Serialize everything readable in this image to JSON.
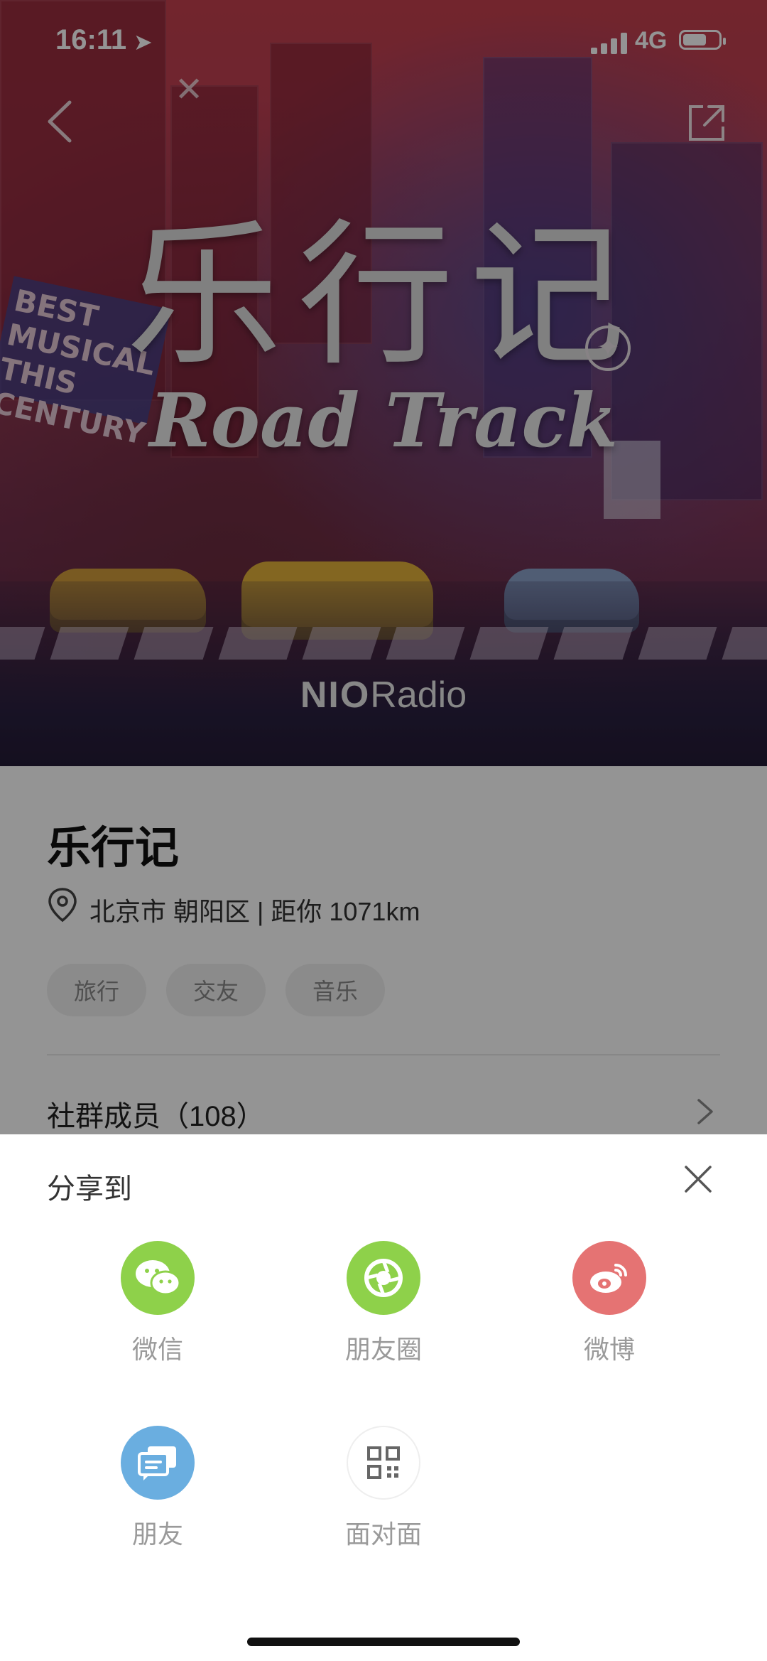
{
  "status_bar": {
    "time": "16:11",
    "network": "4G"
  },
  "hero": {
    "title_cn": "乐行记",
    "title_en": "Road Track",
    "brand_bold": "NIO",
    "brand_light": "Radio"
  },
  "group": {
    "name": "乐行记",
    "location": "北京市 朝阳区 | 距你 1071km",
    "tags": [
      "旅行",
      "交友",
      "音乐"
    ],
    "members_label": "社群成员（108）"
  },
  "share_sheet": {
    "title": "分享到",
    "options": [
      {
        "label": "微信",
        "icon": "wechat-icon",
        "color": "#8ed14a"
      },
      {
        "label": "朋友圈",
        "icon": "moments-icon",
        "color": "#8ed14a"
      },
      {
        "label": "微博",
        "icon": "weibo-icon",
        "color": "#e57373"
      },
      {
        "label": "朋友",
        "icon": "friends-icon",
        "color": "#6aaee0"
      },
      {
        "label": "面对面",
        "icon": "qrcode-icon",
        "color": "#ffffff"
      }
    ]
  }
}
